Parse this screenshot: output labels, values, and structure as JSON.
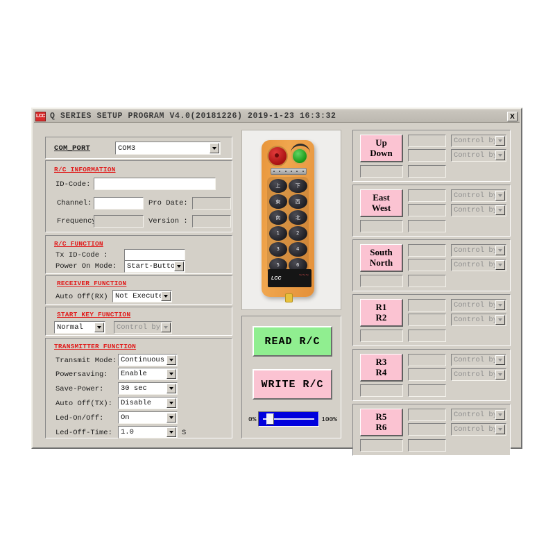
{
  "window": {
    "logo": "LCC",
    "title": "Q SERIES SETUP PROGRAM  V4.0(20181226)  2019-1-23 16:3:32",
    "close_label": "X"
  },
  "com_port": {
    "label": "COM_PORT",
    "value": "COM3"
  },
  "rc_information": {
    "title": "R/C INFORMATION",
    "id_code_label": "ID-Code:",
    "id_code_value": "",
    "channel_label": "Channel:",
    "channel_value": "",
    "pro_date_label": "Pro Date:",
    "pro_date_value": "",
    "frequency_label": "Frequency",
    "frequency_value": "",
    "version_label": "Version :",
    "version_value": ""
  },
  "rc_function": {
    "title": "R/C FUNCTION",
    "tx_id_code_label": "Tx ID-Code :",
    "tx_id_code_value": "",
    "power_on_mode_label": "Power On Mode:",
    "power_on_mode_value": "Start-Button"
  },
  "receiver_function": {
    "title": "RECEIVER FUNCTION",
    "auto_off_rx_label": "Auto Off(RX)",
    "auto_off_rx_value": "Not Execute"
  },
  "start_key_function": {
    "title": "START KEY FUNCTION",
    "mode_value": "Normal",
    "control_value": "Control by EM"
  },
  "transmitter_function": {
    "title": "TRANSMITTER FUNCTION",
    "rows": [
      {
        "label": "Transmit Mode:",
        "value": "Continuous",
        "suffix": ""
      },
      {
        "label": "Powersaving:",
        "value": "Enable",
        "suffix": ""
      },
      {
        "label": "Save-Power:",
        "value": "30 sec",
        "suffix": ""
      },
      {
        "label": "Auto Off(TX):",
        "value": "Disable",
        "suffix": ""
      },
      {
        "label": "Led-On/Off:",
        "value": "On",
        "suffix": ""
      },
      {
        "label": "Led-Off-Time:",
        "value": "1.0",
        "suffix": "S"
      }
    ]
  },
  "remote": {
    "brand": "LCC",
    "keys": [
      "上",
      "下",
      "東",
      "西",
      "南",
      "北",
      "1",
      "2",
      "3",
      "4",
      "5",
      "6"
    ]
  },
  "actions": {
    "read_label": "READ R/C",
    "write_label": "WRITE R/C",
    "progress_min_label": "0%",
    "progress_max_label": "100%",
    "progress_value": 8
  },
  "channels": [
    {
      "name": "up-down",
      "line1": "Up",
      "line2": "Down",
      "field1": "",
      "field2": "",
      "select1": "Control by EM",
      "select2": "Control by EM",
      "field3": "",
      "field4": ""
    },
    {
      "name": "east-west",
      "line1": "East",
      "line2": "West",
      "field1": "",
      "field2": "",
      "select1": "Control by EM",
      "select2": "Control by EM",
      "field3": "",
      "field4": ""
    },
    {
      "name": "south-north",
      "line1": "South",
      "line2": "North",
      "field1": "",
      "field2": "",
      "select1": "Control by EM",
      "select2": "Control by EM",
      "field3": "",
      "field4": ""
    },
    {
      "name": "r1-r2",
      "line1": "R1",
      "line2": "R2",
      "field1": "",
      "field2": "",
      "select1": "Control by EM",
      "select2": "Control by EM",
      "field3": "",
      "field4": ""
    },
    {
      "name": "r3-r4",
      "line1": "R3",
      "line2": "R4",
      "field1": "",
      "field2": "",
      "select1": "Control by EM",
      "select2": "Control by EM",
      "field3": "",
      "field4": ""
    },
    {
      "name": "r5-r6",
      "line1": "R5",
      "line2": "R6",
      "field1": "",
      "field2": "",
      "select1": "Control by EM",
      "select2": "Control by EM",
      "field3": "",
      "field4": ""
    }
  ],
  "colors": {
    "face": "#d4d0c8",
    "accent_red": "#e01b1b",
    "pink": "#fbc3d2",
    "green": "#90ee90",
    "blue": "#0000dd"
  }
}
